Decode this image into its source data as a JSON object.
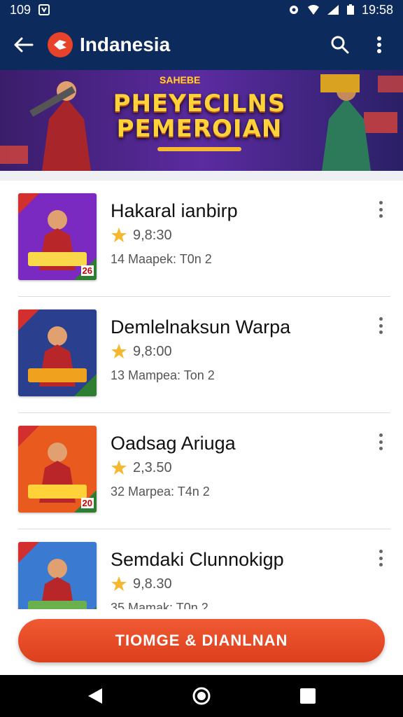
{
  "status_bar": {
    "left_time": "109",
    "right_time": "19:58"
  },
  "app_bar": {
    "title": "Indanesia",
    "logo_icon": "logo-icon",
    "back_icon": "back-arrow-icon",
    "search_icon": "search-icon",
    "more_icon": "more-vert-icon"
  },
  "banner": {
    "title_line1": "PHEYECILNS",
    "title_line2": "PEMEROIAN",
    "badge_text": "SAHEBE"
  },
  "items": [
    {
      "title": "Hakaral ianbirp",
      "rating": "9,8:30",
      "meta": "14 Maapek: T0n 2",
      "thumb_bg": "#7a2ac0",
      "thumb_accent": "#f9d84a",
      "corner_label": "26"
    },
    {
      "title": "Demlelnaksun Warpa",
      "rating": "9,8:00",
      "meta": "13 Mampea: Ton 2",
      "thumb_bg": "#2b3f8f",
      "thumb_accent": "#f0a21e",
      "corner_label": ""
    },
    {
      "title": "Oadsag Ariuga",
      "rating": "2,3.50",
      "meta": "32 Marpea: T4n 2",
      "thumb_bg": "#e85a1e",
      "thumb_accent": "#ffd23a",
      "corner_label": "20"
    },
    {
      "title": "Semdaki Clunnokigp",
      "rating": "9,8.30",
      "meta": "35 Mamak: T0n 2",
      "thumb_bg": "#3a7ad0",
      "thumb_accent": "#6ab04c",
      "corner_label": ""
    }
  ],
  "cta": {
    "label": "TIOMGE & DIANLNAN"
  },
  "nav": {
    "back": "nav-back-icon",
    "home": "nav-home-icon",
    "recents": "nav-recents-icon"
  },
  "colors": {
    "app_bar": "#0d2a5c",
    "accent": "#e8432a",
    "star": "#f5b82e"
  }
}
